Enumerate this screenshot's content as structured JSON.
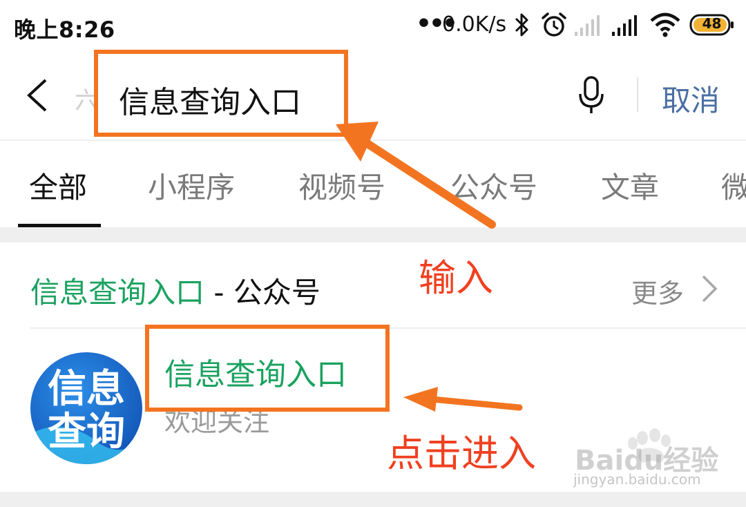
{
  "status_bar": {
    "time": "晚上8:26",
    "dots": "•••",
    "network_speed": "0.0K/s",
    "battery_level": "48",
    "icons": [
      "bluetooth-icon",
      "alarm-icon",
      "signal-icon",
      "signal-icon",
      "wifi-icon",
      "battery-icon"
    ]
  },
  "search": {
    "query": "信息查询入口",
    "hint_glyph": "六",
    "cancel_label": "取消"
  },
  "tabs": [
    {
      "label": "全部",
      "active": true
    },
    {
      "label": "小程序"
    },
    {
      "label": "视频号"
    },
    {
      "label": "公众号"
    },
    {
      "label": "文章"
    },
    {
      "label": "微"
    }
  ],
  "results": {
    "section_title_keyword": "信息查询入口",
    "section_title_suffix": " - 公众号",
    "more_label": "更多",
    "items": [
      {
        "name": "信息查询入口",
        "description": "欢迎关注",
        "avatar_text_line1": "信息",
        "avatar_text_line2": "查询"
      }
    ]
  },
  "annotations": {
    "input_label": "输入",
    "click_label": "点击进入"
  },
  "watermark": {
    "brand": "Baidu经验",
    "url": "jingyan.baidu.com"
  },
  "colors": {
    "accent_green": "#1aa260",
    "cancel_blue": "#4a6fa3",
    "annotation_orange": "#f37420",
    "annotation_text_red": "#f04020"
  }
}
